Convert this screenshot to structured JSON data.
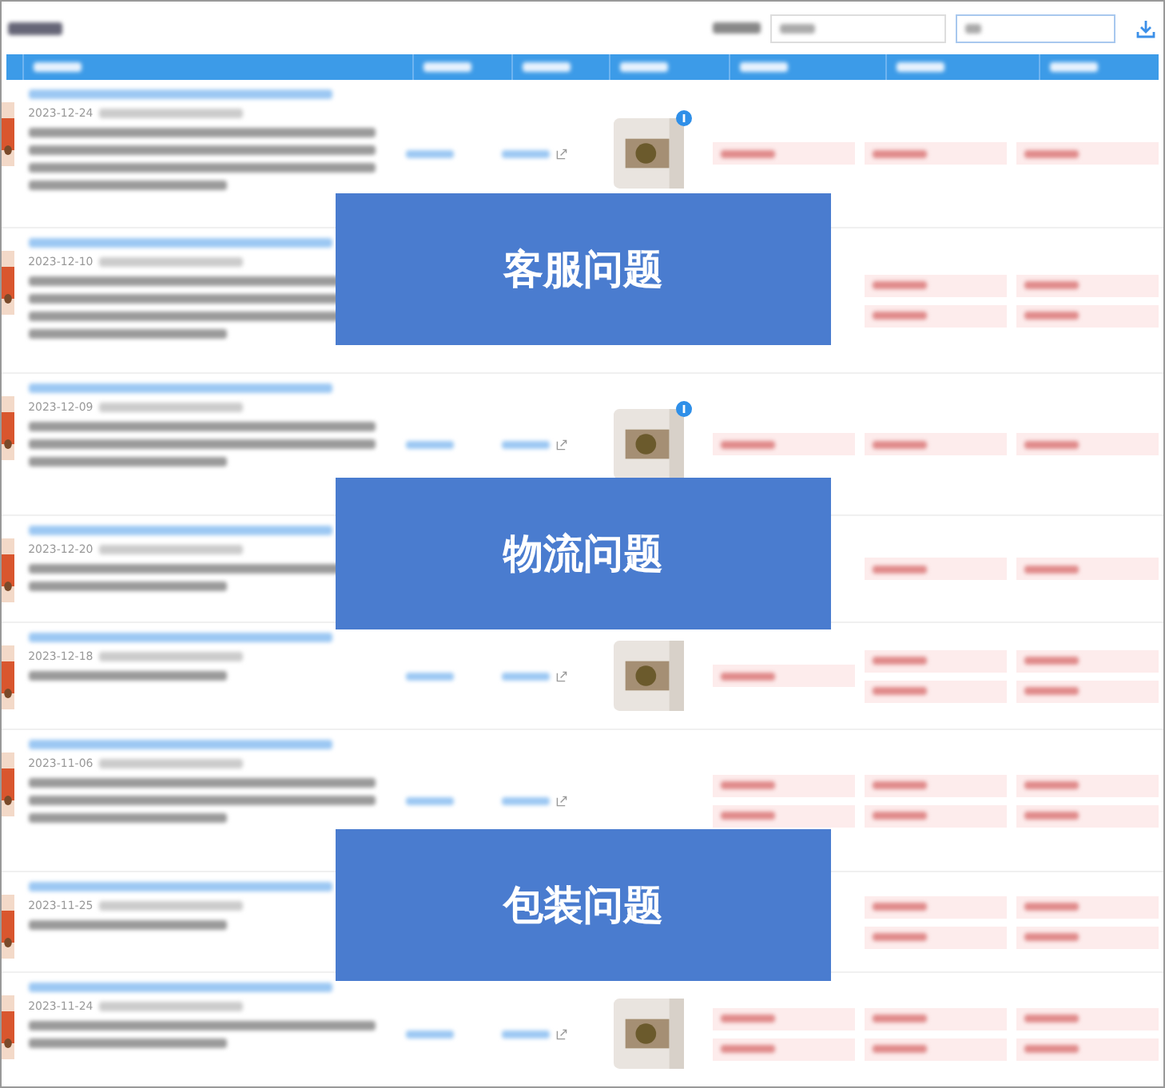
{
  "overlays": [
    {
      "label": "客服问题"
    },
    {
      "label": "物流问题"
    },
    {
      "label": "包装问题"
    }
  ],
  "rows": [
    {
      "date": "2023-12-24",
      "image": true,
      "badge": true
    },
    {
      "date": "2023-12-10",
      "image": false
    },
    {
      "date": "2023-12-09",
      "image": true,
      "badge": true
    },
    {
      "date": "2023-12-20",
      "image": false
    },
    {
      "date": "2023-12-18",
      "image": true,
      "badge": false
    },
    {
      "date": "2023-11-06",
      "image": false
    },
    {
      "date": "2023-11-25",
      "image": false
    },
    {
      "date": "2023-11-24",
      "image": true,
      "badge": false
    }
  ]
}
